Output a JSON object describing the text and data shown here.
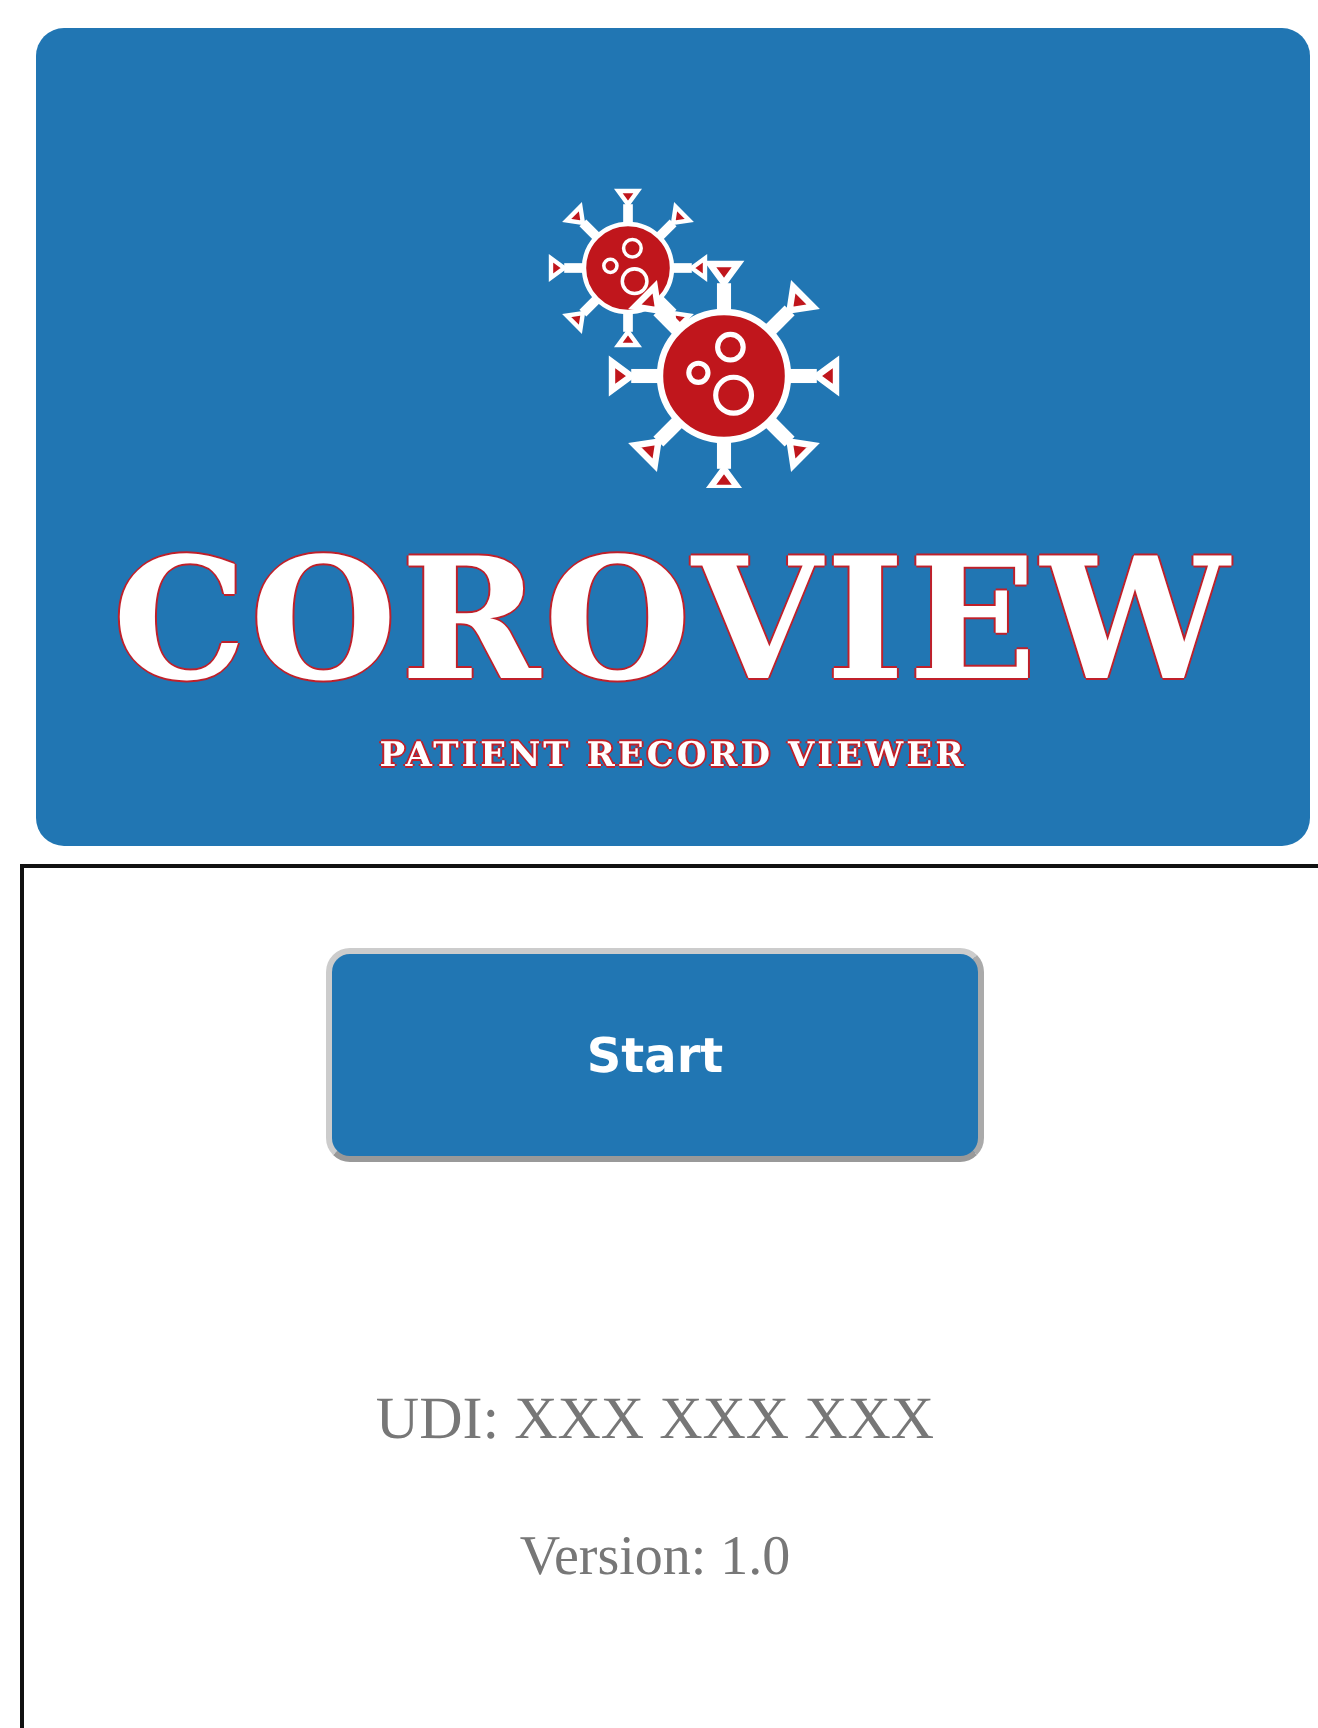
{
  "banner": {
    "title": "COROVIEW",
    "subtitle": "PATIENT RECORD VIEWER"
  },
  "start_button": {
    "label": "Start"
  },
  "udi": "UDI: XXX XXX XXX",
  "version": "Version: 1.0"
}
